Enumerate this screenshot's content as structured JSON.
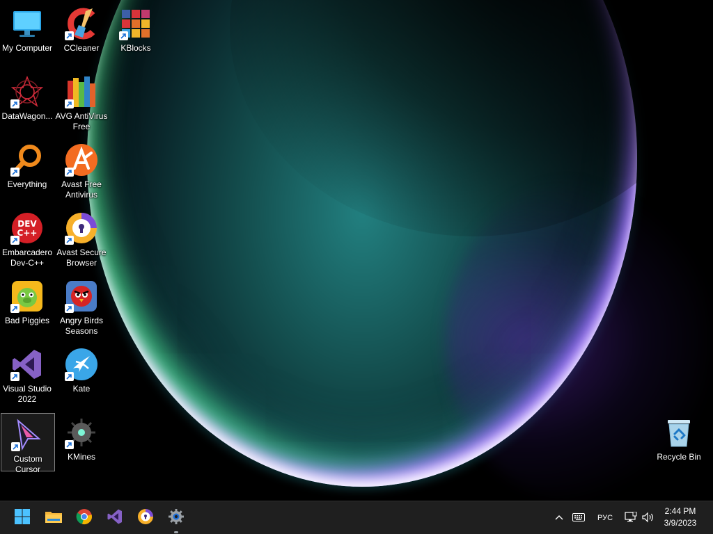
{
  "desktop": {
    "icons": [
      {
        "label": "My Computer",
        "icon": "computer-icon"
      },
      {
        "label": "CCleaner",
        "icon": "ccleaner-icon"
      },
      {
        "label": "KBlocks",
        "icon": "kblocks-icon"
      },
      {
        "label": "DataWagon...",
        "icon": "datawagon-icon"
      },
      {
        "label": "AVG AntiVirus Free",
        "icon": "avg-icon"
      },
      {
        "label": "Everything",
        "icon": "everything-search-icon"
      },
      {
        "label": "Avast Free Antivirus",
        "icon": "avast-icon"
      },
      {
        "label": "Embarcadero Dev-C++",
        "icon": "devcpp-icon"
      },
      {
        "label": "Avast Secure Browser",
        "icon": "avast-browser-icon"
      },
      {
        "label": "Bad Piggies",
        "icon": "bad-piggies-icon"
      },
      {
        "label": "Angry Birds Seasons",
        "icon": "angry-birds-icon"
      },
      {
        "label": "Visual Studio 2022",
        "icon": "visual-studio-icon"
      },
      {
        "label": "Kate",
        "icon": "kate-icon"
      },
      {
        "label": "Custom Cursor",
        "icon": "custom-cursor-icon",
        "selected": true
      },
      {
        "label": "KMines",
        "icon": "kmines-icon"
      },
      {
        "label": "Recycle Bin",
        "icon": "recycle-bin-icon"
      }
    ]
  },
  "taskbar": {
    "pinned": [
      {
        "name": "Start",
        "icon": "windows-start-icon"
      },
      {
        "name": "File Explorer",
        "icon": "folder-icon"
      },
      {
        "name": "Google Chrome",
        "icon": "chrome-icon"
      },
      {
        "name": "Visual Studio",
        "icon": "visual-studio-icon"
      },
      {
        "name": "Avast Secure Browser",
        "icon": "avast-browser-icon"
      },
      {
        "name": "Settings",
        "icon": "gear-icon",
        "active": true
      }
    ],
    "tray": {
      "language": "РУС",
      "time": "2:44 PM",
      "date": "3/9/2023"
    }
  },
  "colors": {
    "taskbar_bg": "#1f1f1f",
    "accent_blue": "#3aa0ff"
  }
}
